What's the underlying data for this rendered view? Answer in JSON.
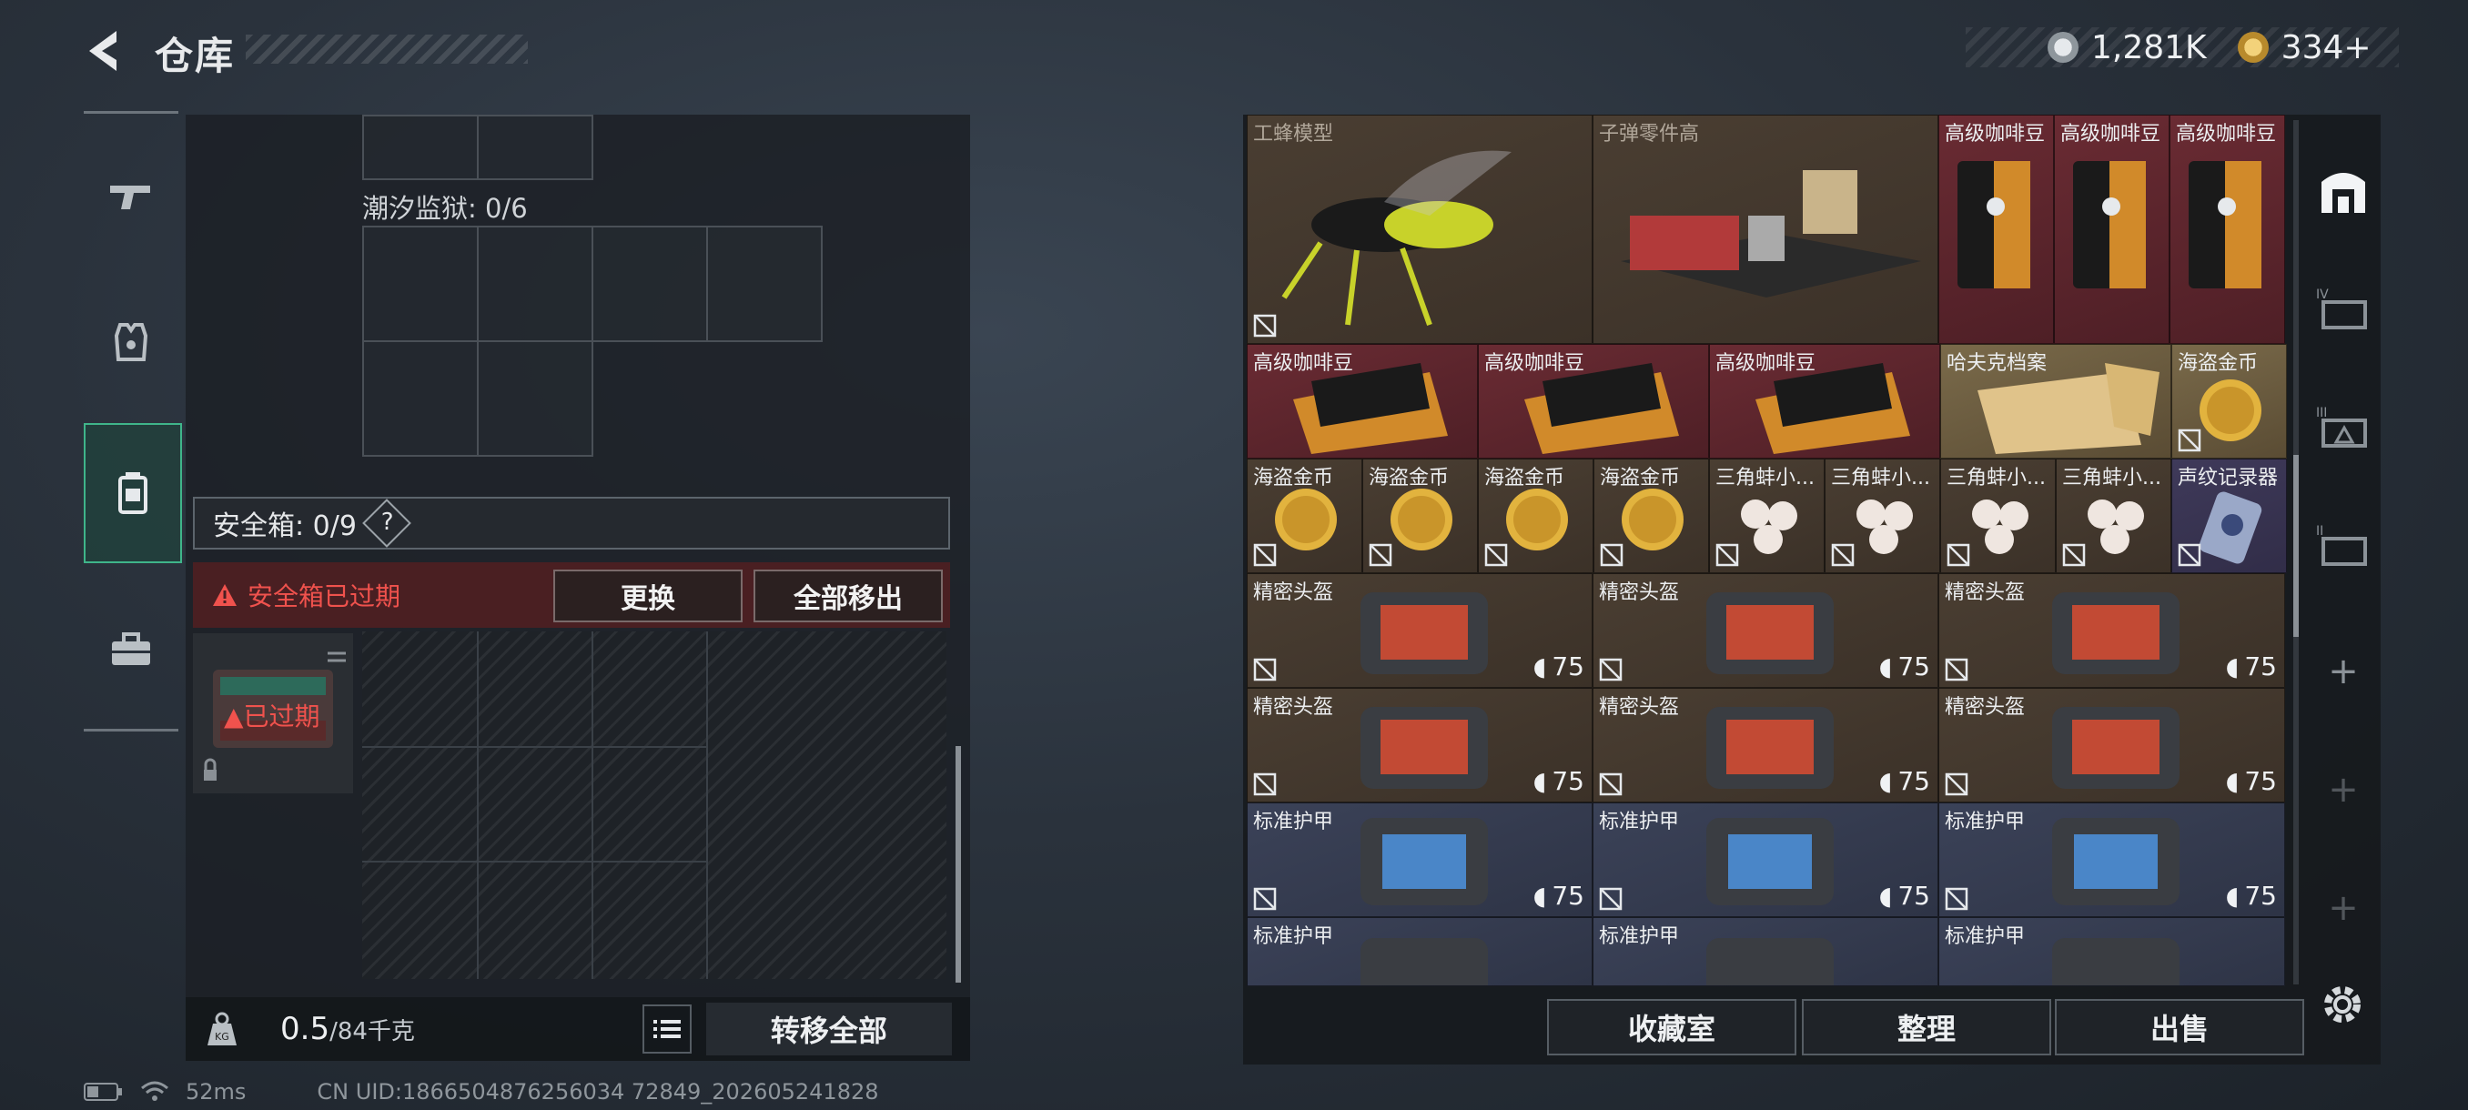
{
  "header": {
    "title": "仓库",
    "currency_1": "1,281K",
    "currency_2": "334",
    "currency_2_add": "+"
  },
  "left_panel": {
    "zone_label": "潮汐监狱: 0/6",
    "safe_box_label": "安全箱: 0/9",
    "help_label": "?",
    "warning": "安全箱已过期",
    "replace_button": "更换",
    "remove_all_button": "全部移出",
    "expired_badge": "已过期",
    "weight_value": "0.5",
    "weight_unit": "/84千克",
    "transfer_all_button": "转移全部"
  },
  "status_bar": {
    "ping": "52ms",
    "uid": "CN UID:1866504876256034 72849_202605241828"
  },
  "items": [
    {
      "name": "工蜂模型",
      "dim": true
    },
    {
      "name": "子弹零件高",
      "dim": true
    },
    {
      "name": "高级咖啡豆"
    },
    {
      "name": "高级咖啡豆"
    },
    {
      "name": "高级咖啡豆"
    },
    {
      "name": "高级咖啡豆"
    },
    {
      "name": "高级咖啡豆"
    },
    {
      "name": "高级咖啡豆"
    },
    {
      "name": "哈夫克档案"
    },
    {
      "name": "海盗金币"
    },
    {
      "name": "海盗金币"
    },
    {
      "name": "海盗金币"
    },
    {
      "name": "海盗金币"
    },
    {
      "name": "海盗金币"
    },
    {
      "name": "三角蚌小..."
    },
    {
      "name": "三角蚌小..."
    },
    {
      "name": "三角蚌小..."
    },
    {
      "name": "三角蚌小..."
    },
    {
      "name": "声纹记录器"
    },
    {
      "name": "精密头盔",
      "durability": "75"
    },
    {
      "name": "精密头盔",
      "durability": "75"
    },
    {
      "name": "精密头盔",
      "durability": "75"
    },
    {
      "name": "精密头盔",
      "durability": "75"
    },
    {
      "name": "精密头盔",
      "durability": "75"
    },
    {
      "name": "精密头盔",
      "durability": "75"
    },
    {
      "name": "标准护甲",
      "durability": "75"
    },
    {
      "name": "标准护甲",
      "durability": "75"
    },
    {
      "name": "标准护甲",
      "durability": "75"
    },
    {
      "name": "标准护甲"
    },
    {
      "name": "标准护甲"
    },
    {
      "name": "标准护甲"
    }
  ],
  "right_buttons": {
    "collection": "收藏室",
    "organize": "整理",
    "sell": "出售"
  },
  "right_tabs": [
    "IV",
    "III",
    "II"
  ],
  "colors": {
    "accent_green": "#3fb58a",
    "warn_red": "#f0524d",
    "gold": "#c9a33a"
  }
}
